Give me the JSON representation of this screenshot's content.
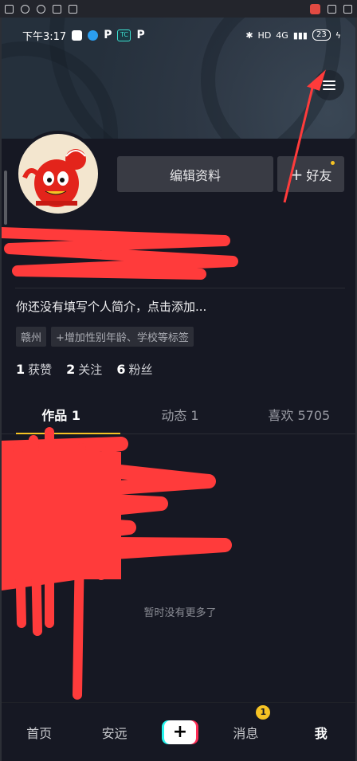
{
  "status": {
    "time": "下午3:17",
    "network": "4G",
    "battery": "23"
  },
  "profile": {
    "edit_label": "编辑资料",
    "friend_label": "好友",
    "bio": "你还没有填写个人简介，点击添加...",
    "tags": [
      "赣州",
      "+增加性别年龄、学校等标签"
    ]
  },
  "stats": [
    {
      "count": "1",
      "label": "获赞"
    },
    {
      "count": "2",
      "label": "关注"
    },
    {
      "count": "6",
      "label": "粉丝"
    }
  ],
  "tabs": [
    {
      "label": "作品 1"
    },
    {
      "label": "动态 1"
    },
    {
      "label": "喜欢 5705"
    }
  ],
  "empty_text": "暂时没有更多了",
  "nav": {
    "home": "首页",
    "friend": "安远",
    "plus": "+",
    "messages": "消息",
    "messages_badge": "1",
    "me": "我"
  },
  "colors": {
    "accent": "#f6c324",
    "bg": "#161823",
    "annotation": "#ff3b3b"
  }
}
